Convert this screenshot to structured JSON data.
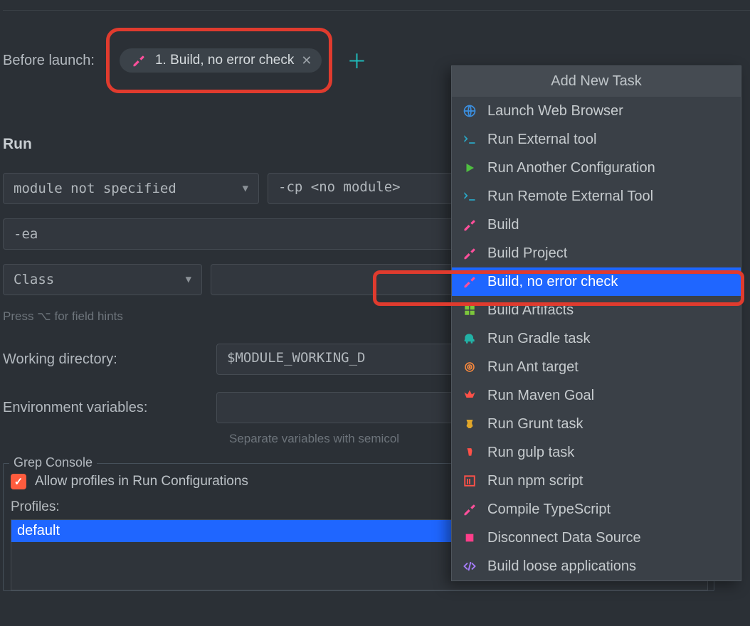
{
  "before_launch": {
    "label": "Before launch:",
    "chip_text": "1. Build, no error check"
  },
  "run": {
    "heading": "Run",
    "module_select": "module not specified",
    "cp_field": "-cp <no module>",
    "ea_field": "-ea",
    "class_select": "Class",
    "hint": "Press ⌥ for field hints",
    "working_dir_label": "Working directory:",
    "working_dir_value": "$MODULE_WORKING_D",
    "env_label": "Environment variables:",
    "env_hint": "Separate variables with semicol"
  },
  "grep": {
    "legend": "Grep Console",
    "checkbox_label": "Allow profiles in Run Configurations",
    "profiles_label": "Profiles:",
    "profile_selected": "default"
  },
  "popup": {
    "title": "Add New Task",
    "items": [
      {
        "label": "Launch Web Browser",
        "icon": "globe",
        "color": "c-blue"
      },
      {
        "label": "Run External tool",
        "icon": "prompt",
        "color": "c-term"
      },
      {
        "label": "Run Another Configuration",
        "icon": "play",
        "color": "c-green"
      },
      {
        "label": "Run Remote External Tool",
        "icon": "prompt",
        "color": "c-term"
      },
      {
        "label": "Build",
        "icon": "hammer",
        "color": "c-pink"
      },
      {
        "label": "Build Project",
        "icon": "hammer",
        "color": "c-pink"
      },
      {
        "label": "Build, no error check",
        "icon": "hammer",
        "color": "c-pink",
        "selected": true
      },
      {
        "label": "Build Artifacts",
        "icon": "squares",
        "color": "c-lime"
      },
      {
        "label": "Run Gradle task",
        "icon": "elephant",
        "color": "c-teal"
      },
      {
        "label": "Run Ant target",
        "icon": "target",
        "color": "c-orange"
      },
      {
        "label": "Run Maven Goal",
        "icon": "check",
        "color": "c-red"
      },
      {
        "label": "Run Grunt task",
        "icon": "grunt",
        "color": "c-yel"
      },
      {
        "label": "Run gulp task",
        "icon": "cup",
        "color": "c-red"
      },
      {
        "label": "Run npm script",
        "icon": "npm",
        "color": "c-brd"
      },
      {
        "label": "Compile TypeScript",
        "icon": "hammer",
        "color": "c-pk2"
      },
      {
        "label": "Disconnect Data Source",
        "icon": "square",
        "color": "c-mag"
      },
      {
        "label": "Build loose applications",
        "icon": "code",
        "color": "c-pur"
      }
    ]
  }
}
